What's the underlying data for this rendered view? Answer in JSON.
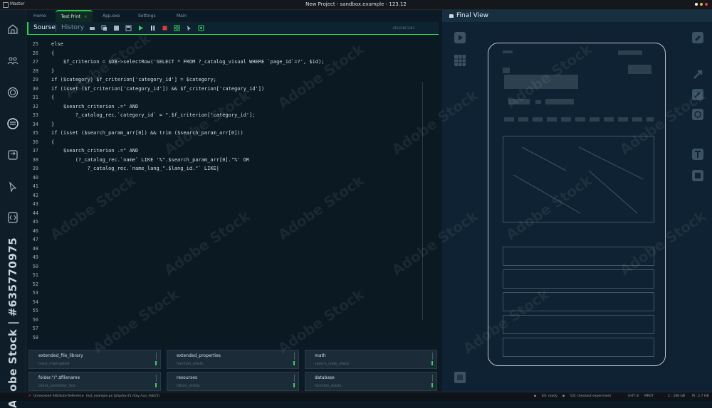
{
  "window": {
    "app_name": "Master",
    "title": "New Project - sandbox.example - 123.12"
  },
  "tabs": [
    {
      "label": "Home"
    },
    {
      "label": "Test Print",
      "close": "×"
    },
    {
      "label": "App.exe"
    },
    {
      "label": "Settings"
    },
    {
      "label": "Main"
    }
  ],
  "toolbar": {
    "source_label": "Sourse",
    "history_label": "History",
    "meta": "426,6389 1283"
  },
  "code_lines": [
    {
      "n": "25",
      "t": "else"
    },
    {
      "n": "26",
      "t": "{"
    },
    {
      "n": "27",
      "t": "    $f_criterion = $DB->selectRow('SELECT * FROM ?_catalog_visual WHERE `page_id`=?', $id);"
    },
    {
      "n": "28",
      "t": "}"
    },
    {
      "n": "29",
      "t": "if ($category) $f_criterion['category_id'] = $category;"
    },
    {
      "n": "30",
      "t": "if (isset ($f_criterion['category_id']) && $f_criterion['category_id'])"
    },
    {
      "n": "31",
      "t": "{"
    },
    {
      "n": "32",
      "t": "    $search_criterion .=\" AND"
    },
    {
      "n": "33",
      "t": "        ?_catalog_rec.`category_id` = \".$f_criterion['category_id'];"
    },
    {
      "n": "34",
      "t": "}"
    },
    {
      "n": "35",
      "t": "if (isset ($search_param_arr[0]) && trim ($search_param_arr[0]))"
    },
    {
      "n": "36",
      "t": "{"
    },
    {
      "n": "37",
      "t": "    $search_criterion .=\" AND"
    },
    {
      "n": "38",
      "t": "        (?_catalog_rec.`name` LIKE '%\".$search_param_arr[0].\"%' OR"
    },
    {
      "n": "39",
      "t": "            ?_catalog_rec.`name_lang_\".$lang_id.\"` LIKE|"
    },
    {
      "n": "40",
      "t": ""
    },
    {
      "n": "41",
      "t": ""
    },
    {
      "n": "42",
      "t": ""
    },
    {
      "n": "43",
      "t": ""
    },
    {
      "n": "44",
      "t": ""
    },
    {
      "n": "45",
      "t": ""
    },
    {
      "n": "46",
      "t": ""
    },
    {
      "n": "47",
      "t": ""
    },
    {
      "n": "48",
      "t": ""
    },
    {
      "n": "49",
      "t": ""
    },
    {
      "n": "50",
      "t": ""
    },
    {
      "n": "51",
      "t": ""
    },
    {
      "n": "52",
      "t": ""
    },
    {
      "n": "53",
      "t": ""
    },
    {
      "n": "54",
      "t": ""
    },
    {
      "n": "55",
      "t": ""
    },
    {
      "n": "56",
      "t": ""
    },
    {
      "n": "57",
      "t": ""
    },
    {
      "n": "58",
      "t": ""
    }
  ],
  "cards": [
    {
      "title": "extended_file_library",
      "sub": "track_interrupted"
    },
    {
      "title": "extended_properties",
      "sub": "function_exists"
    },
    {
      "title": "math",
      "sub": "search_code_check"
    },
    {
      "title": "folder.\"/\".$filename",
      "sub": "client_controller_test"
    },
    {
      "title": "resourses",
      "sub": "return_string"
    },
    {
      "title": "database",
      "sub": "function_exists"
    }
  ],
  "status": {
    "error": "Unresolved Attribute Reference",
    "file": "test_example.px (php/hp-25 /day /run_Feb15)",
    "kx": "KX: ready",
    "git": "Git: checkout experiment",
    "ght": "GHT: 8",
    "mr": "MR07",
    "c": "C : 180 GB",
    "m": "M : 2.7 GB"
  },
  "right_panel": {
    "title": "Final View"
  },
  "watermark": {
    "vertical": "Adobe Stock | #635770975",
    "diag": "Adobe Stock"
  },
  "colors": {
    "accent_green": "#2ad24e",
    "bg": "#0c1a26",
    "panel": "#0f2233"
  }
}
